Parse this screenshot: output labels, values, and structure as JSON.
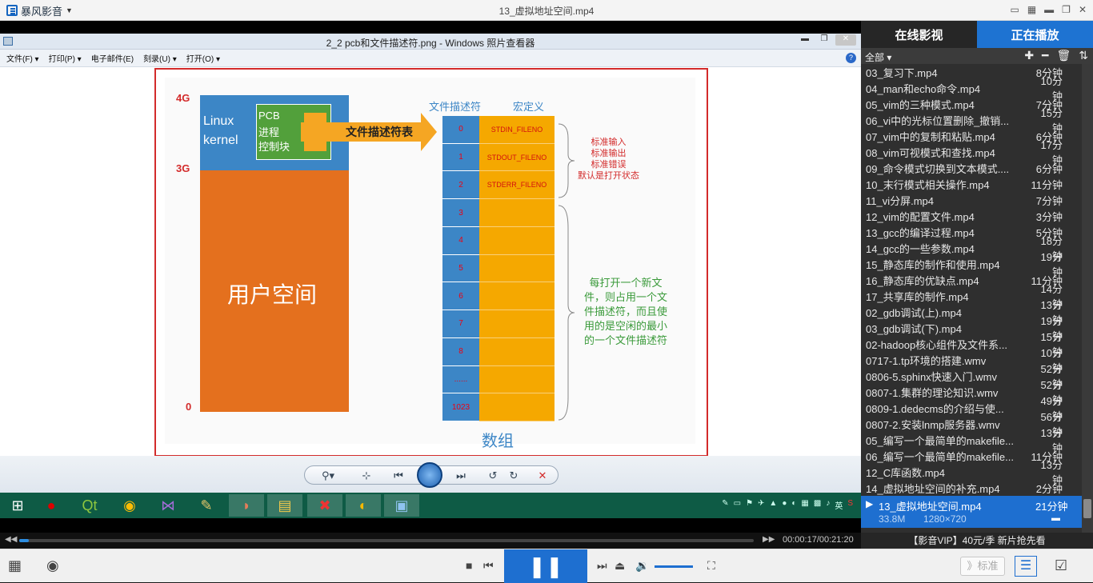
{
  "app": {
    "brand": "暴风影音",
    "window_title": "13_虚拟地址空间.mp4"
  },
  "viewer": {
    "title": "2_2 pcb和文件描述符.png - Windows 照片查看器",
    "menu": [
      "文件(F) ▾",
      "打印(P) ▾",
      "电子邮件(E)",
      "刻录(U) ▾",
      "打开(O) ▾"
    ]
  },
  "slide": {
    "labels_left": {
      "top": "4G",
      "mid": "3G",
      "bottom": "0"
    },
    "kernel": "Linux kernel",
    "kernel_l1": "Linux",
    "kernel_l2": "kernel",
    "pcb_l1": "PCB",
    "pcb_l2": "进程",
    "pcb_l3": "控制块",
    "user_space": "用户空间",
    "fd_table_arrow": "文件描述符表",
    "col_fd": "文件描述符",
    "col_macro": "宏定义",
    "fd_rows": [
      {
        "fd": "0",
        "macro": "STDIN_FILENO"
      },
      {
        "fd": "1",
        "macro": "STDOUT_FILENO"
      },
      {
        "fd": "2",
        "macro": "STDERR_FILENO"
      },
      {
        "fd": "3",
        "macro": ""
      },
      {
        "fd": "4",
        "macro": ""
      },
      {
        "fd": "5",
        "macro": ""
      },
      {
        "fd": "6",
        "macro": ""
      },
      {
        "fd": "7",
        "macro": ""
      },
      {
        "fd": "8",
        "macro": ""
      },
      {
        "fd": "......",
        "macro": ""
      },
      {
        "fd": "1023",
        "macro": ""
      }
    ],
    "std_note": [
      "标准输入",
      "标准输出",
      "标准错误",
      "默认是打开状态"
    ],
    "new_file_note": [
      "每打开一个新文",
      "件，则占用一个文",
      "件描述符，而且使",
      "用的是空闲的最小",
      "的一个文件描述符"
    ],
    "array_label": "数组"
  },
  "sidebar": {
    "tab_online": "在线影视",
    "tab_playing": "正在播放",
    "filter": "全部 ▾",
    "items": [
      {
        "name": "03_复习下.mp4",
        "dur": "8分钟"
      },
      {
        "name": "04_man和echo命令.mp4",
        "dur": "10分钟"
      },
      {
        "name": "05_vim的三种模式.mp4",
        "dur": "7分钟"
      },
      {
        "name": "06_vi中的光标位置删除_撤销...",
        "dur": "15分钟"
      },
      {
        "name": "07_vim中的复制和粘贴.mp4",
        "dur": "6分钟"
      },
      {
        "name": "08_vim可视模式和查找.mp4",
        "dur": "17分钟"
      },
      {
        "name": "09_命令模式切换到文本模式....",
        "dur": "6分钟"
      },
      {
        "name": "10_末行模式相关操作.mp4",
        "dur": "11分钟"
      },
      {
        "name": "11_vi分屏.mp4",
        "dur": "7分钟"
      },
      {
        "name": "12_vim的配置文件.mp4",
        "dur": "3分钟"
      },
      {
        "name": "13_gcc的编译过程.mp4",
        "dur": "5分钟"
      },
      {
        "name": "14_gcc的一些参数.mp4",
        "dur": "18分钟"
      },
      {
        "name": "15_静态库的制作和使用.mp4",
        "dur": "19分钟"
      },
      {
        "name": "16_静态库的优缺点.mp4",
        "dur": "11分钟"
      },
      {
        "name": "17_共享库的制作.mp4",
        "dur": "14分钟"
      },
      {
        "name": "02_gdb调试(上).mp4",
        "dur": "13分钟"
      },
      {
        "name": "03_gdb调试(下).mp4",
        "dur": "19分钟"
      },
      {
        "name": "02-hadoop核心组件及文件系...",
        "dur": "15分钟"
      },
      {
        "name": "0717-1.tp环境的搭建.wmv",
        "dur": "10分钟"
      },
      {
        "name": "0806-5.sphinx快速入门.wmv",
        "dur": "52分钟"
      },
      {
        "name": "0807-1.集群的理论知识.wmv",
        "dur": "52分钟"
      },
      {
        "name": "0809-1.dedecms的介绍与使...",
        "dur": "49分钟"
      },
      {
        "name": "0807-2.安装lnmp服务器.wmv",
        "dur": "56分钟"
      },
      {
        "name": "05_编写一个最简单的makefile...",
        "dur": "13分钟"
      },
      {
        "name": "06_编写一个最简单的makefile...",
        "dur": "11分钟"
      },
      {
        "name": "12_C库函数.mp4",
        "dur": "13分钟"
      },
      {
        "name": "14_虚拟地址空间的补充.mp4",
        "dur": "2分钟"
      }
    ],
    "current": {
      "name": "13_虚拟地址空间.mp4",
      "dur": "21分钟",
      "size": "33.8M",
      "res": "1280×720"
    },
    "vip": "【影音VIP】40元/季 新片抢先看"
  },
  "player": {
    "time": "00:00:17/00:21:20",
    "progress": 0.013,
    "std_label": "》标准"
  }
}
